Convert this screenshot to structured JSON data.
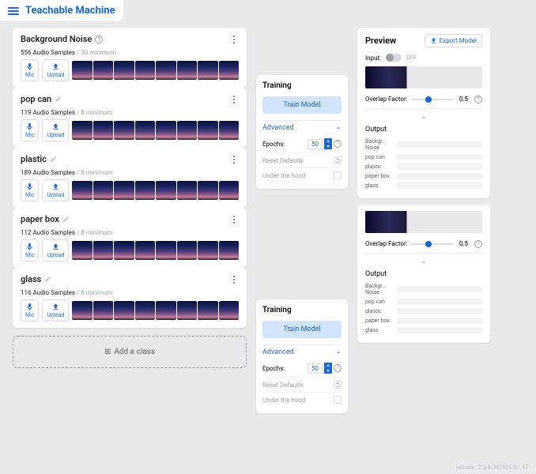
{
  "brand": "Teachable Machine",
  "classes": [
    {
      "name": "Background Noise",
      "samples": "556 Audio Samples",
      "min": "/ 30 minimum",
      "hasHelp": true
    },
    {
      "name": "pop can",
      "samples": "119 Audio Samples",
      "min": "/ 8 minimum"
    },
    {
      "name": "plastic",
      "samples": "189 Audio Samples",
      "min": "/ 8 minimum"
    },
    {
      "name": "paper box",
      "samples": "112 Audio Samples",
      "min": "/ 8 minimum"
    },
    {
      "name": "glass",
      "samples": "116 Audio Samples",
      "min": "/ 8 minimum"
    }
  ],
  "micLabel": "Mic",
  "uploadLabel": "Upload",
  "addClass": "Add a class",
  "training": {
    "title": "Training",
    "trainBtn": "Train Model",
    "advanced": "Advanced",
    "epochsLabel": "Epochs:",
    "epochsVal": "50",
    "reset": "Reset Defaults",
    "underHood": "Under the hood"
  },
  "preview": {
    "title": "Preview",
    "export": "Export Model",
    "inputLabel": "Input:",
    "inputState": "OFF",
    "overlapLabel": "Overlap Factor:",
    "overlapVal": "0.5",
    "outputTitle": "Output",
    "outputs": [
      "Backgr... Noise",
      "pop can",
      "plastic",
      "paper box",
      "glass"
    ]
  },
  "version": "release · 2.3.0/20240516 · 17"
}
